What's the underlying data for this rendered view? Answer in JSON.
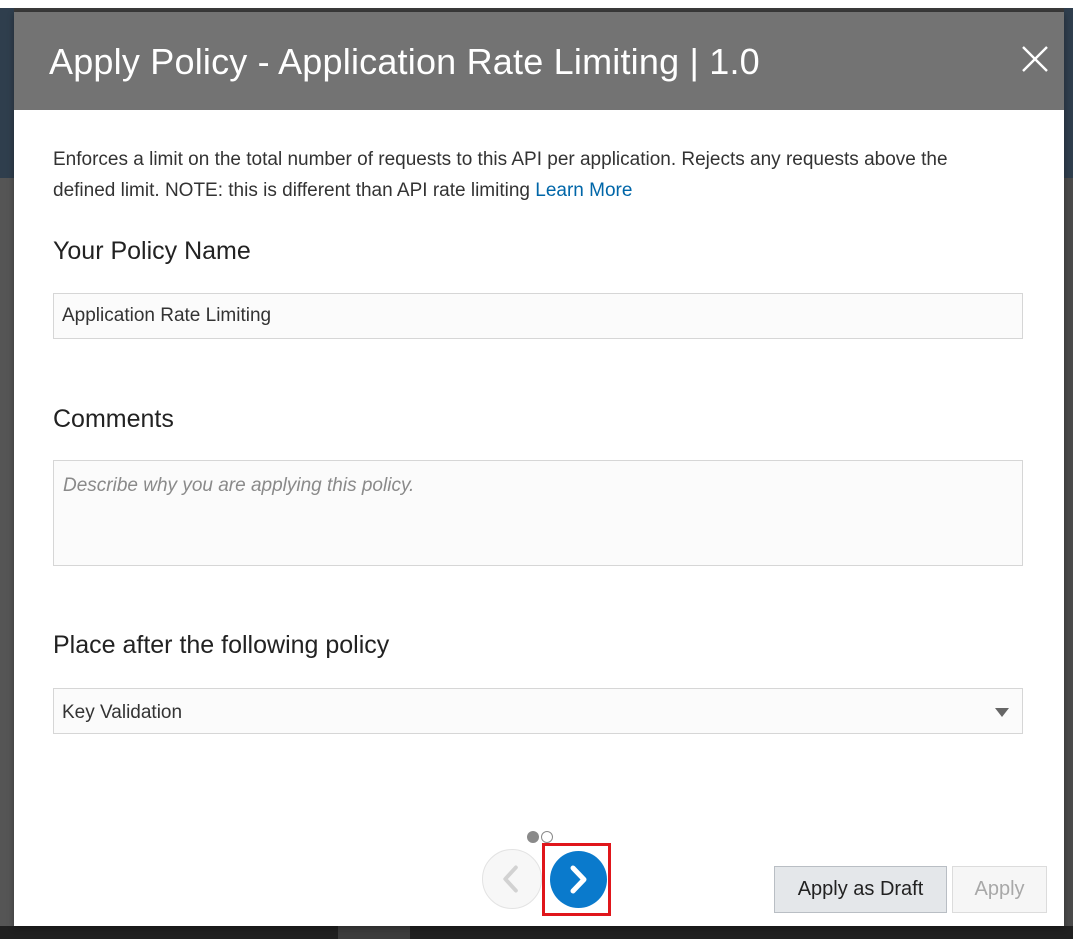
{
  "dialog": {
    "title": "Apply Policy - Application Rate Limiting | 1.0",
    "close_icon": "close-icon",
    "description": "Enforces a limit on the total number of requests to this API per application. Rejects any requests above the defined limit. NOTE: this is different than API rate limiting",
    "learn_more": "Learn More"
  },
  "form": {
    "policy_name_label": "Your Policy Name",
    "policy_name_value": "Application Rate Limiting",
    "comments_label": "Comments",
    "comments_placeholder": "Describe why you are applying this policy.",
    "place_after_label": "Place after the following policy",
    "place_after_value": "Key Validation"
  },
  "pager": {
    "total_pages": 2,
    "current_page": 1,
    "prev_icon": "chevron-left-icon",
    "next_icon": "chevron-right-icon"
  },
  "actions": {
    "apply_as_draft": "Apply as Draft",
    "apply": "Apply"
  },
  "colors": {
    "header_bg": "#737373",
    "link": "#0066a8",
    "next_button": "#0a7acc",
    "highlight_border": "#e0161b"
  }
}
